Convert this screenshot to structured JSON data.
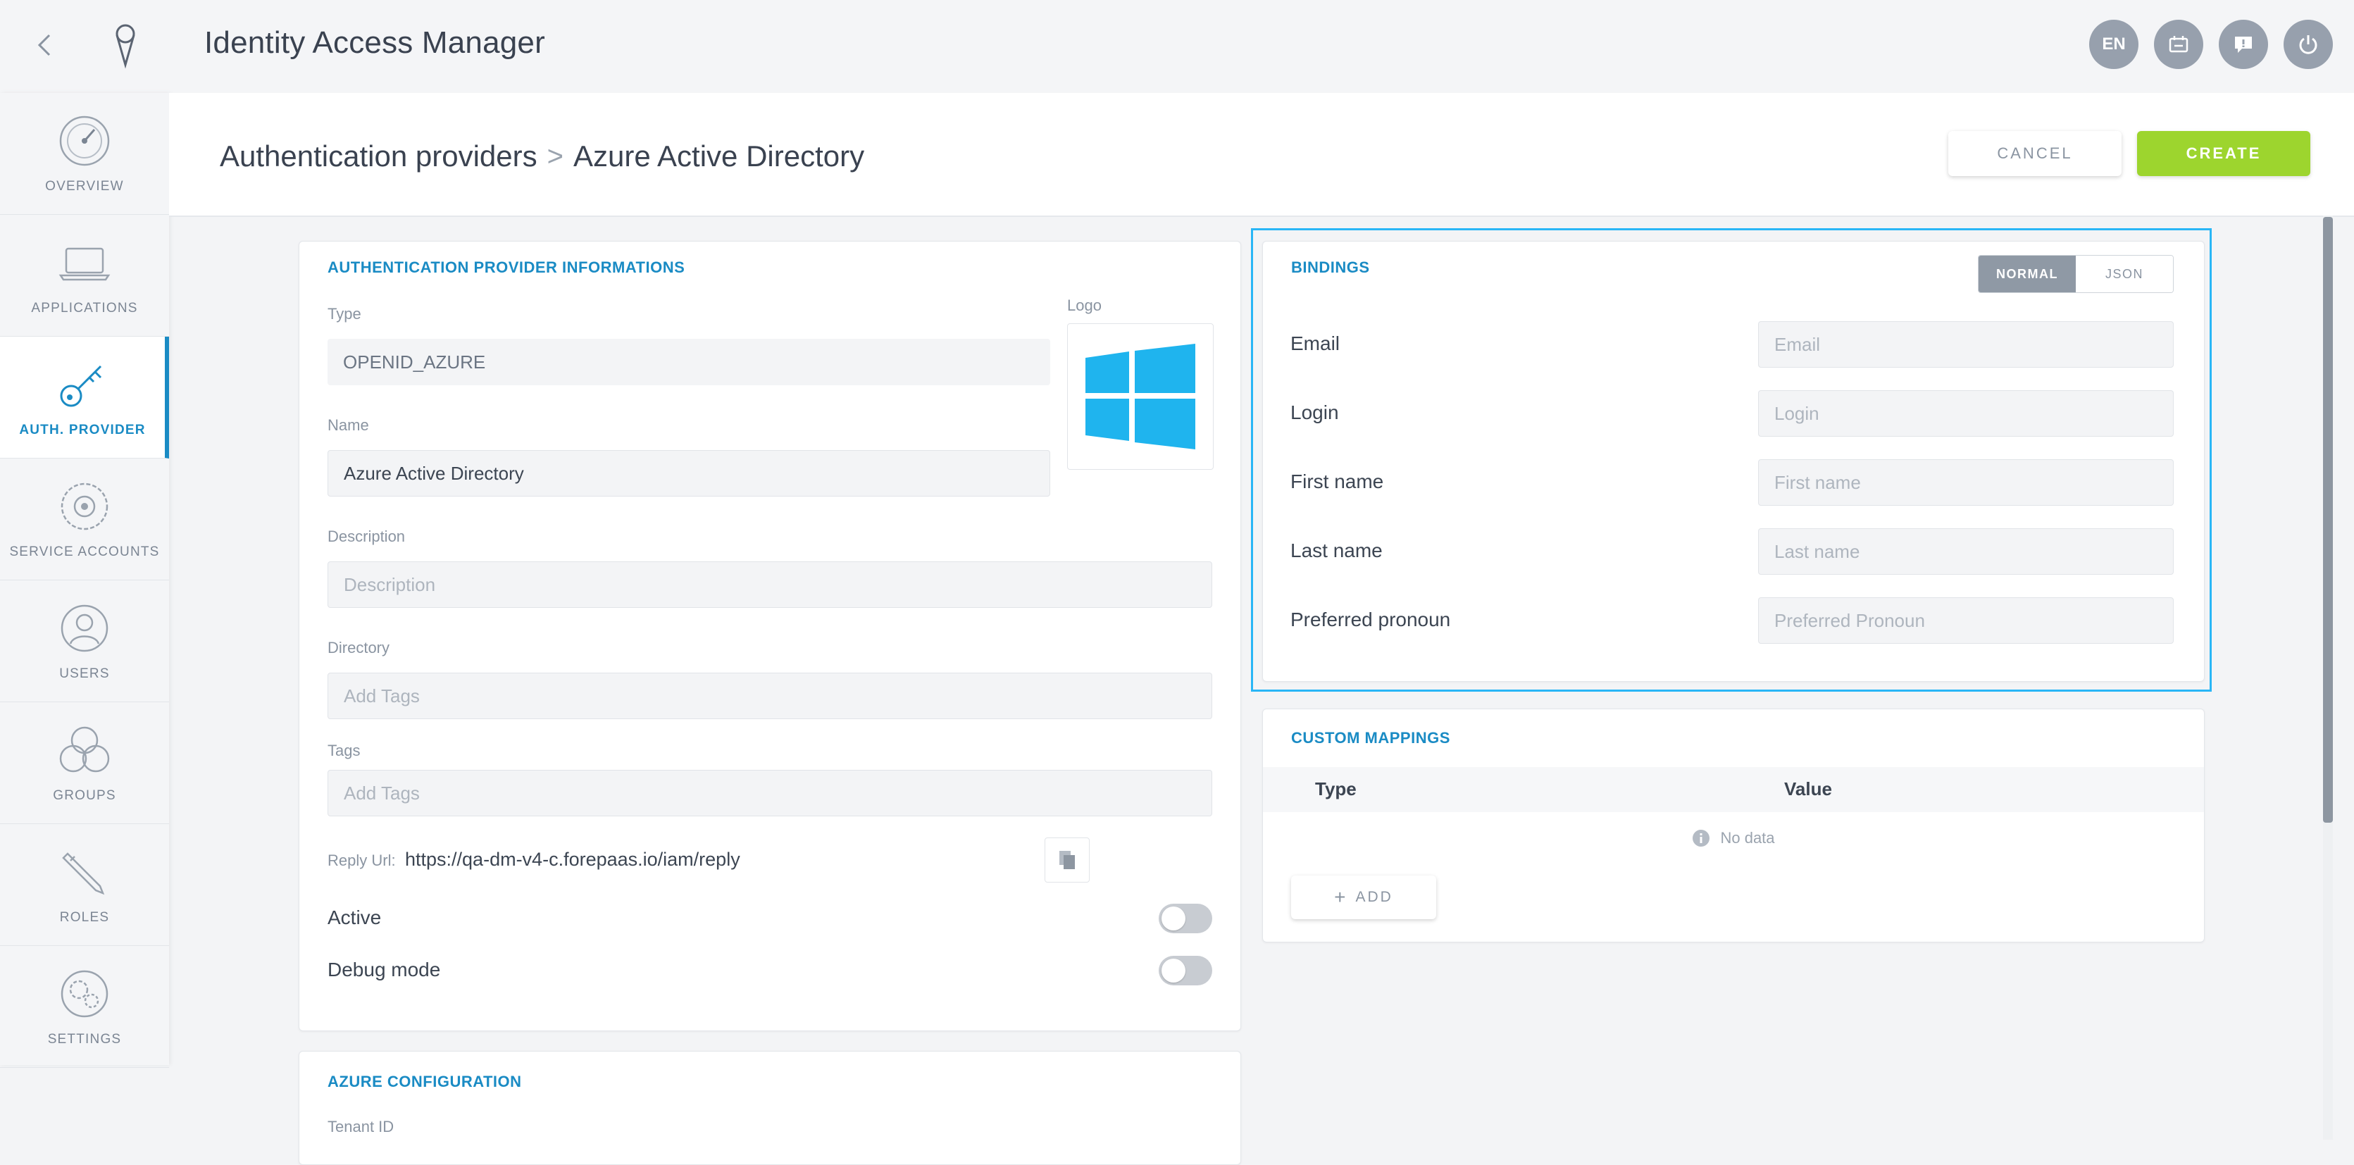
{
  "app": {
    "title": "Identity Access Manager"
  },
  "topbar": {
    "language": "EN"
  },
  "sidebar": {
    "items": [
      {
        "label": "OVERVIEW",
        "icon": "gauge-icon"
      },
      {
        "label": "APPLICATIONS",
        "icon": "laptop-icon"
      },
      {
        "label": "AUTH. PROVIDER",
        "icon": "key-icon",
        "active": true
      },
      {
        "label": "SERVICE ACCOUNTS",
        "icon": "gear-badge-icon"
      },
      {
        "label": "USERS",
        "icon": "user-icon"
      },
      {
        "label": "GROUPS",
        "icon": "group-icon"
      },
      {
        "label": "ROLES",
        "icon": "pencil-icon"
      },
      {
        "label": "SETTINGS",
        "icon": "settings-icon"
      }
    ]
  },
  "header": {
    "breadcrumb_root": "Authentication providers",
    "breadcrumb_separator": ">",
    "breadcrumb_current": "Azure Active Directory",
    "cancel_label": "CANCEL",
    "create_label": "CREATE"
  },
  "info": {
    "title": "AUTHENTICATION PROVIDER INFORMATIONS",
    "type_label": "Type",
    "type_value": "OPENID_AZURE",
    "logo_label": "Logo",
    "name_label": "Name",
    "name_value": "Azure Active Directory",
    "description_label": "Description",
    "description_placeholder": "Description",
    "directory_label": "Directory",
    "directory_placeholder": "Add Tags",
    "tags_label": "Tags",
    "tags_placeholder": "Add Tags",
    "reply_url_label": "Reply Url:",
    "reply_url_value": "https://qa-dm-v4-c.forepaas.io/iam/reply",
    "active_label": "Active",
    "active_on": false,
    "debug_label": "Debug mode",
    "debug_on": false
  },
  "azure": {
    "title": "AZURE CONFIGURATION",
    "tenant_label": "Tenant ID"
  },
  "bindings": {
    "title": "BINDINGS",
    "mode_normal": "NORMAL",
    "mode_json": "JSON",
    "selected_mode": "NORMAL",
    "rows": [
      {
        "label": "Email",
        "placeholder": "Email"
      },
      {
        "label": "Login",
        "placeholder": "Login"
      },
      {
        "label": "First name",
        "placeholder": "First name"
      },
      {
        "label": "Last name",
        "placeholder": "Last name"
      },
      {
        "label": "Preferred pronoun",
        "placeholder": "Preferred Pronoun"
      }
    ]
  },
  "custom_mappings": {
    "title": "CUSTOM MAPPINGS",
    "col_type": "Type",
    "col_value": "Value",
    "empty_text": "No data",
    "add_label": "ADD"
  },
  "colors": {
    "accent": "#1a8bc4",
    "create": "#9dd52e",
    "windows_logo": "#1fb4ee",
    "highlight_border": "#29b6f6"
  }
}
